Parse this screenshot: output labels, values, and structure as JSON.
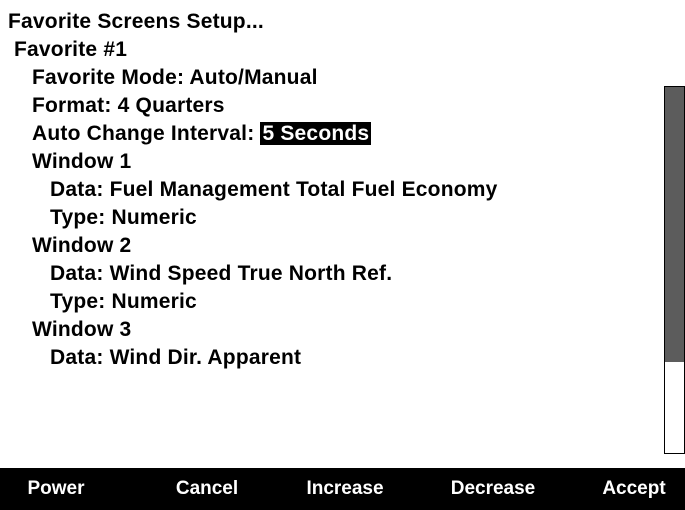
{
  "title": "Favorite Screens Setup...",
  "favorite_label": "Favorite #1",
  "settings": {
    "mode": {
      "label": "Favorite Mode:",
      "value": "Auto/Manual"
    },
    "format": {
      "label": "Format:",
      "value": "4 Quarters"
    },
    "interval": {
      "label": "Auto Change Interval:",
      "value": "5 Seconds"
    }
  },
  "windows": [
    {
      "label": "Window 1",
      "data": {
        "label": "Data:",
        "value": "Fuel Management Total Fuel Economy"
      },
      "type": {
        "label": "Type:",
        "value": "Numeric"
      }
    },
    {
      "label": "Window 2",
      "data": {
        "label": "Data:",
        "value": "Wind Speed True North Ref."
      },
      "type": {
        "label": "Type:",
        "value": "Numeric"
      }
    },
    {
      "label": "Window 3",
      "data": {
        "label": "Data:",
        "value": "Wind Dir. Apparent"
      }
    }
  ],
  "scrollbar": {
    "thumb_fraction": 0.75,
    "position_fraction": 0.0,
    "thumb_color": "#5c5c5c"
  },
  "softkeys": {
    "power": "Power",
    "cancel": "Cancel",
    "increase": "Increase",
    "decrease": "Decrease",
    "accept": "Accept"
  },
  "colors": {
    "background": "#ffffff",
    "text": "#000000",
    "softkey_bar": "#000000",
    "softkey_text": "#ffffff",
    "selection_bg": "#000000",
    "selection_text": "#ffffff"
  }
}
